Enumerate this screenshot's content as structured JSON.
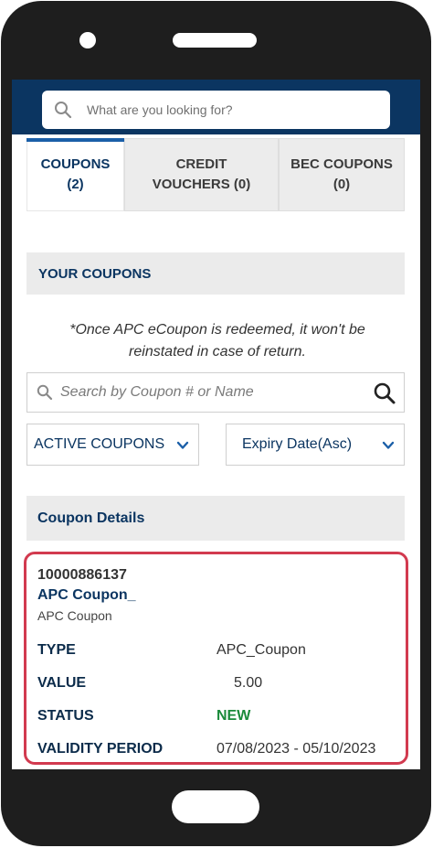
{
  "search": {
    "placeholder": "What are you looking for?"
  },
  "tabs": [
    {
      "line1": "COUPONS",
      "line2": "(2)",
      "active": true
    },
    {
      "line1": "CREDIT",
      "line2": "VOUCHERS (0)",
      "active": false
    },
    {
      "line1": "BEC COUPONS",
      "line2": "(0)",
      "active": false
    }
  ],
  "your_coupons": {
    "title": "YOUR COUPONS"
  },
  "note": {
    "line1": "*Once APC eCoupon is redeemed, it won't be",
    "line2": "reinstated in case of return."
  },
  "coupon_search": {
    "placeholder": "Search by Coupon # or Name"
  },
  "filters": {
    "status_selected": "ACTIVE COUPONS",
    "sort_selected": "Expiry Date(Asc)"
  },
  "details": {
    "title": "Coupon Details"
  },
  "coupon": {
    "number": "10000886137",
    "name": "APC Coupon_",
    "subtitle": "APC Coupon",
    "rows": [
      {
        "label": "TYPE",
        "value": "APC_Coupon"
      },
      {
        "label": "VALUE",
        "value": "5.00"
      },
      {
        "label": "STATUS",
        "value": "NEW"
      },
      {
        "label": "VALIDITY PERIOD",
        "value": "07/08/2023 - 05/10/2023"
      }
    ]
  },
  "colors": {
    "brand_navy": "#0b3561",
    "tab_accent": "#1b5fa8",
    "status_new": "#1a8a3a",
    "highlight": "#d23a4f"
  },
  "icons": [
    "search-icon",
    "chevron-down-icon"
  ]
}
